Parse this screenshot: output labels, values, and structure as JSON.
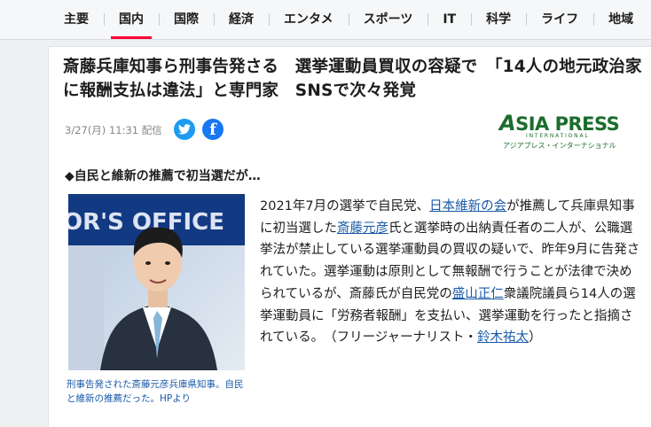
{
  "nav": {
    "items": [
      "主要",
      "国内",
      "国際",
      "経済",
      "エンタメ",
      "スポーツ",
      "IT",
      "科学",
      "ライフ",
      "地域"
    ],
    "active": "国内"
  },
  "article": {
    "title": "斎藤兵庫知事ら刑事告発さる　選挙運動員買収の容疑で　「14人の地元政治家に報酬支払は違法」と専門家　SNSで次々発覚",
    "date": "3/27(月) 11:31",
    "distribution": "配信",
    "source_logo": {
      "name": "ASIA PRESS",
      "sub": "INTERNATIONAL",
      "kana": "アジアプレス・インターナショナル"
    },
    "subheading": "◆自民と維新の推薦で初当選だが…",
    "photo_caption": "刑事告発された斎藤元彦兵庫県知事。自民と維新の推薦だった。HPより",
    "photo_sign_text": "OR'S OFFICE",
    "body": {
      "p1": "2021年7月の選挙で自民党、",
      "link1": "日本維新の会",
      "p2": "が推薦して兵庫県知事に初当選した",
      "link2": "斎藤元彦",
      "p3": "氏と選挙時の出納責任者の二人が、公職選挙法が禁止している選挙運動員の買収の疑いで、昨年9月に告発されていた。選挙運動は原則として無報酬で行うことが法律で決められているが、斎藤氏が自民党の",
      "link3": "盛山正仁",
      "p4": "衆議院議員ら14人の選挙運動員に「労務者報酬」を支払い、選挙運動を行ったと指摘されている。　（フリージャーナリスト・",
      "link4": "鈴木祐太",
      "p5": "）"
    }
  },
  "colors": {
    "accent": "#ff0033",
    "link": "#1a5aa8",
    "twitter": "#1d9bf0",
    "facebook": "#1877f2",
    "logo_green": "#1a6d2c"
  }
}
